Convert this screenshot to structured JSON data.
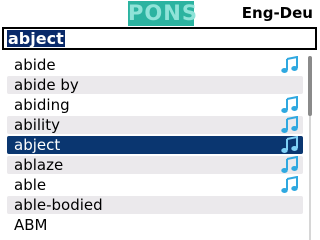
{
  "header": {
    "logo_text": "PONS",
    "dictionary": "Eng-Deu"
  },
  "search": {
    "value": "abject"
  },
  "results": [
    {
      "word": "abide",
      "audio": true,
      "selected": false
    },
    {
      "word": "abide by",
      "audio": false,
      "selected": false
    },
    {
      "word": "abiding",
      "audio": true,
      "selected": false
    },
    {
      "word": "ability",
      "audio": true,
      "selected": false
    },
    {
      "word": "abject",
      "audio": true,
      "selected": true
    },
    {
      "word": "ablaze",
      "audio": true,
      "selected": false
    },
    {
      "word": "able",
      "audio": true,
      "selected": false
    },
    {
      "word": "able-bodied",
      "audio": false,
      "selected": false
    },
    {
      "word": "ABM",
      "audio": false,
      "selected": false
    }
  ],
  "colors": {
    "logo_bg": "#2bb3a0",
    "selection": "#0a3670",
    "audio_icon": "#2fa8e0"
  },
  "scrollbar": {
    "position": 0
  }
}
